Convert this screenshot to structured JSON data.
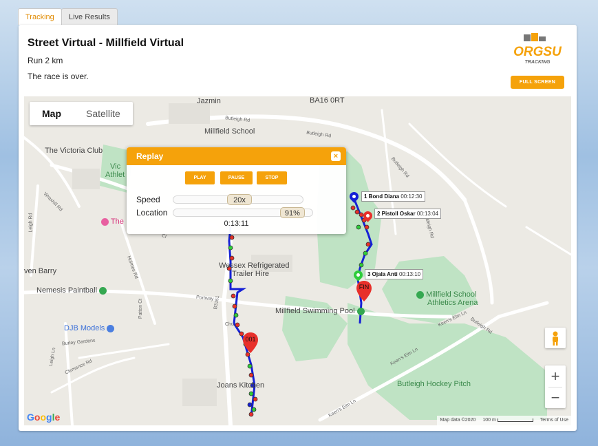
{
  "tabs": [
    {
      "label": "Tracking",
      "active": true
    },
    {
      "label": "Live Results",
      "active": false
    }
  ],
  "event": {
    "title": "Street Virtual - Millfield Virtual",
    "course": "Run 2 km",
    "status": "The race is over."
  },
  "logo": {
    "brand": "ORGSU",
    "sub": "TRACKING"
  },
  "fullscreen_label": "FULL SCREEN",
  "map": {
    "type_buttons": [
      "Map",
      "Satellite"
    ],
    "selected_type": "Map",
    "pois": {
      "jazmin": "Jazmin",
      "ba16": "BA16 0RT",
      "millfield_school": "Millfield School",
      "victoria_club": "The Victoria Club",
      "vic_athlet_1": "Vic",
      "vic_athlet_2": "Athlet",
      "the": "The",
      "wessex": "Wessex Refrigerated",
      "trailer": "Trailer Hire",
      "ven_barry": "ven Barry",
      "nemesis": "Nemesis Paintball",
      "swimming": "Millfield Swimming Pool",
      "athletics1": "Millfield School",
      "athletics2": "Athletics Arena",
      "djb": "DJB Models",
      "joans": "Joans Kitchen",
      "hockey": "Butleigh Hockey Pitch"
    },
    "roads": {
      "butleigh_rd_1": "Butleigh Rd",
      "butleigh_rd_2": "Butleigh Rd",
      "butleigh_rd_3": "Butleigh Rd",
      "butleigh_rd_4": "Butleigh Rd",
      "butleigh_rd_5": "Butleigh Rd",
      "leigh_rd": "Leigh Rd",
      "wraxhill_rd": "Wraxhill Rd",
      "holmes_rd": "Holmes Rd",
      "portway": "Portway",
      "b3151": "B3151",
      "burley": "Burley Gardens",
      "clemence": "Clemence Rd",
      "keens1": "Keen's Elm Ln",
      "keens2": "Keen's Elm Ln",
      "keens3": "Keen's Elm Ln",
      "patton": "Patton Ct",
      "leigh_ln": "Leigh Ln",
      "church": "Chu",
      "cl": "Cl"
    },
    "markers": {
      "start_label": "001",
      "finish_label": "FIN"
    },
    "runners": [
      {
        "label": "1 Bond Diana",
        "time": "00:12:30",
        "color": "#1520d6"
      },
      {
        "label": "2 Pistoll Oskar",
        "time": "00:13:04",
        "color": "#e8302b"
      },
      {
        "label": "3 Ojala Anti",
        "time": "00:13:10",
        "color": "#2ecc3b"
      }
    ],
    "zoom_in": "+",
    "zoom_out": "−",
    "google": "Google",
    "attribution": {
      "data": "Map data ©2020",
      "scale": "100 m",
      "terms": "Terms of Use"
    }
  },
  "replay": {
    "title": "Replay",
    "close": "×",
    "buttons": {
      "play": "PLAY",
      "pause": "PAUSE",
      "stop": "STOP"
    },
    "speed_label": "Speed",
    "speed_value": "20x",
    "location_label": "Location",
    "location_value": "91%",
    "location_fraction": 0.91,
    "elapsed": "0:13:11"
  },
  "colors": {
    "accent": "#f5a20b",
    "route": "#1520d6",
    "park": "#bfe3c4"
  }
}
